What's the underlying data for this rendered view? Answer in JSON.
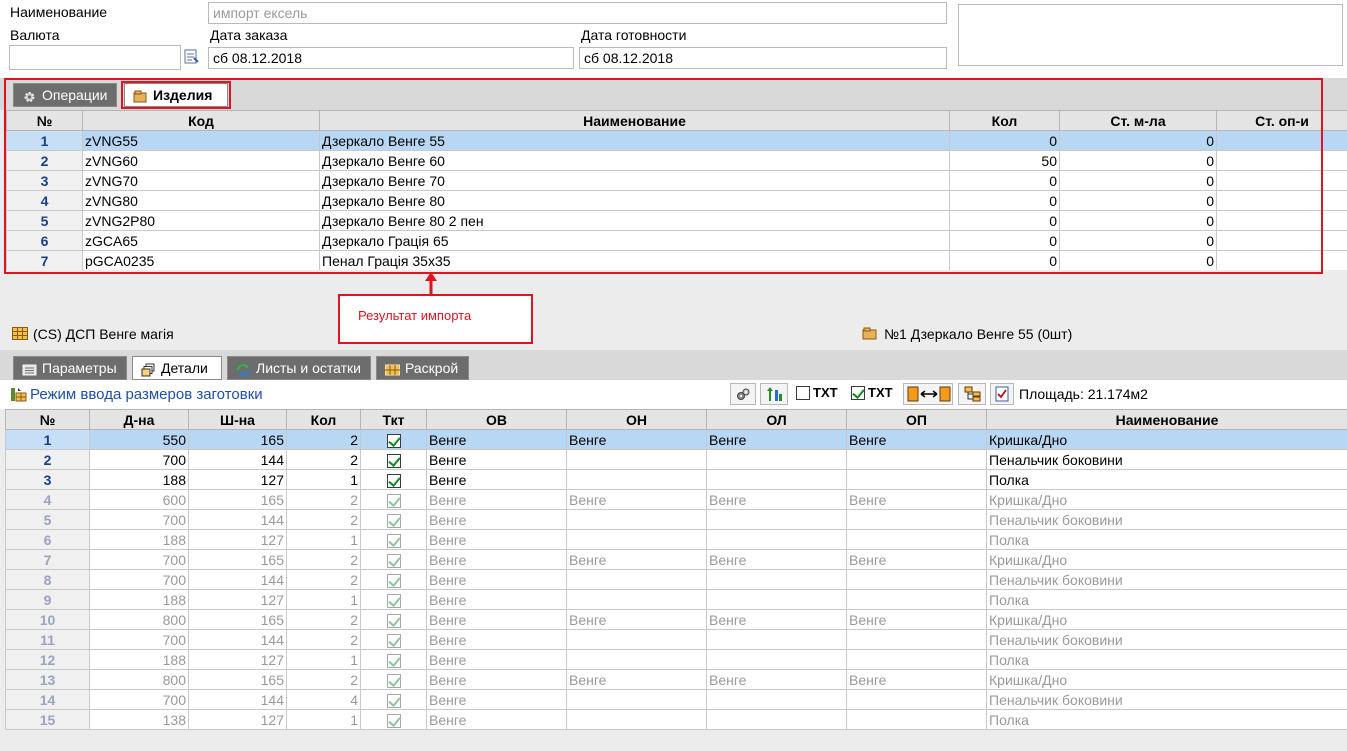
{
  "form": {
    "name_label": "Наименование",
    "name_value": "импорт ексель",
    "currency_label": "Валюта",
    "currency_value": "",
    "order_date_label": "Дата заказа",
    "order_date_value": "сб 08.12.2018",
    "ready_date_label": "Дата готовности",
    "ready_date_value": "сб 08.12.2018",
    "notes_value": ""
  },
  "top_tabs": [
    {
      "label": "Операции",
      "icon": "gear-icon"
    },
    {
      "label": "Изделия",
      "icon": "folder-icon"
    }
  ],
  "products": {
    "columns": [
      "№",
      "Код",
      "Наименование",
      "Кол",
      "Ст. м-ла",
      "Ст. оп-и"
    ],
    "rows": [
      {
        "n": "1",
        "code": "zVNG55",
        "name": "Дзеркало Венге 55",
        "qty": "0",
        "mat": "0",
        "op": ""
      },
      {
        "n": "2",
        "code": "zVNG60",
        "name": "Дзеркало Венге 60",
        "qty": "50",
        "mat": "0",
        "op": ""
      },
      {
        "n": "3",
        "code": "zVNG70",
        "name": "Дзеркало Венге 70",
        "qty": "0",
        "mat": "0",
        "op": ""
      },
      {
        "n": "4",
        "code": "zVNG80",
        "name": "Дзеркало Венге 80",
        "qty": "0",
        "mat": "0",
        "op": ""
      },
      {
        "n": "5",
        "code": "zVNG2P80",
        "name": "Дзеркало Венге 80 2 пен",
        "qty": "0",
        "mat": "0",
        "op": ""
      },
      {
        "n": "6",
        "code": "zGCA65",
        "name": "Дзеркало Грація 65",
        "qty": "0",
        "mat": "0",
        "op": ""
      },
      {
        "n": "7",
        "code": "pGCA0235",
        "name": "Пенал Грація 35х35",
        "qty": "0",
        "mat": "0",
        "op": ""
      }
    ]
  },
  "annotation": {
    "text": "Результат импорта"
  },
  "status": {
    "material": "(CS) ДСП Венге магія",
    "current_product": "№1 Дзеркало Венге 55 (0шт)"
  },
  "bottom_tabs": [
    {
      "label": "Параметры",
      "icon": "list-icon"
    },
    {
      "label": "Детали",
      "icon": "parts-icon"
    },
    {
      "label": "Листы и остатки",
      "icon": "refresh-icon"
    },
    {
      "label": "Раскрой",
      "icon": "cut-icon"
    }
  ],
  "toolbar": {
    "mode_label": "Режим ввода размеров заготовки",
    "txt_off": "TXT",
    "txt_on": "TXT",
    "area": "Площадь: 21.174м2"
  },
  "details": {
    "columns": [
      "№",
      "Д-на",
      "Ш-на",
      "Кол",
      "Ткт",
      "ОВ",
      "ОН",
      "ОЛ",
      "ОП",
      "Наименование"
    ],
    "rows": [
      {
        "n": "1",
        "l": "550",
        "w": "165",
        "q": "2",
        "ov": "Венге",
        "on": "Венге",
        "ol": "Венге",
        "op": "Венге",
        "name": "Кришка/Дно"
      },
      {
        "n": "2",
        "l": "700",
        "w": "144",
        "q": "2",
        "ov": "Венге",
        "on": "",
        "ol": "",
        "op": "",
        "name": "Пенальчик боковини"
      },
      {
        "n": "3",
        "l": "188",
        "w": "127",
        "q": "1",
        "ov": "Венге",
        "on": "",
        "ol": "",
        "op": "",
        "name": "Полка"
      },
      {
        "n": "4",
        "l": "600",
        "w": "165",
        "q": "2",
        "ov": "Венге",
        "on": "Венге",
        "ol": "Венге",
        "op": "Венге",
        "name": "Кришка/Дно"
      },
      {
        "n": "5",
        "l": "700",
        "w": "144",
        "q": "2",
        "ov": "Венге",
        "on": "",
        "ol": "",
        "op": "",
        "name": "Пенальчик боковини"
      },
      {
        "n": "6",
        "l": "188",
        "w": "127",
        "q": "1",
        "ov": "Венге",
        "on": "",
        "ol": "",
        "op": "",
        "name": "Полка"
      },
      {
        "n": "7",
        "l": "700",
        "w": "165",
        "q": "2",
        "ov": "Венге",
        "on": "Венге",
        "ol": "Венге",
        "op": "Венге",
        "name": "Кришка/Дно"
      },
      {
        "n": "8",
        "l": "700",
        "w": "144",
        "q": "2",
        "ov": "Венге",
        "on": "",
        "ol": "",
        "op": "",
        "name": "Пенальчик боковини"
      },
      {
        "n": "9",
        "l": "188",
        "w": "127",
        "q": "1",
        "ov": "Венге",
        "on": "",
        "ol": "",
        "op": "",
        "name": "Полка"
      },
      {
        "n": "10",
        "l": "800",
        "w": "165",
        "q": "2",
        "ov": "Венге",
        "on": "Венге",
        "ol": "Венге",
        "op": "Венге",
        "name": "Кришка/Дно"
      },
      {
        "n": "11",
        "l": "700",
        "w": "144",
        "q": "2",
        "ov": "Венге",
        "on": "",
        "ol": "",
        "op": "",
        "name": "Пенальчик боковини"
      },
      {
        "n": "12",
        "l": "188",
        "w": "127",
        "q": "1",
        "ov": "Венге",
        "on": "",
        "ol": "",
        "op": "",
        "name": "Полка"
      },
      {
        "n": "13",
        "l": "800",
        "w": "165",
        "q": "2",
        "ov": "Венге",
        "on": "Венге",
        "ol": "Венге",
        "op": "Венге",
        "name": "Кришка/Дно"
      },
      {
        "n": "14",
        "l": "700",
        "w": "144",
        "q": "4",
        "ov": "Венге",
        "on": "",
        "ol": "",
        "op": "",
        "name": "Пенальчик боковини"
      },
      {
        "n": "15",
        "l": "138",
        "w": "127",
        "q": "1",
        "ov": "Венге",
        "on": "",
        "ol": "",
        "op": "",
        "name": "Полка"
      }
    ]
  }
}
